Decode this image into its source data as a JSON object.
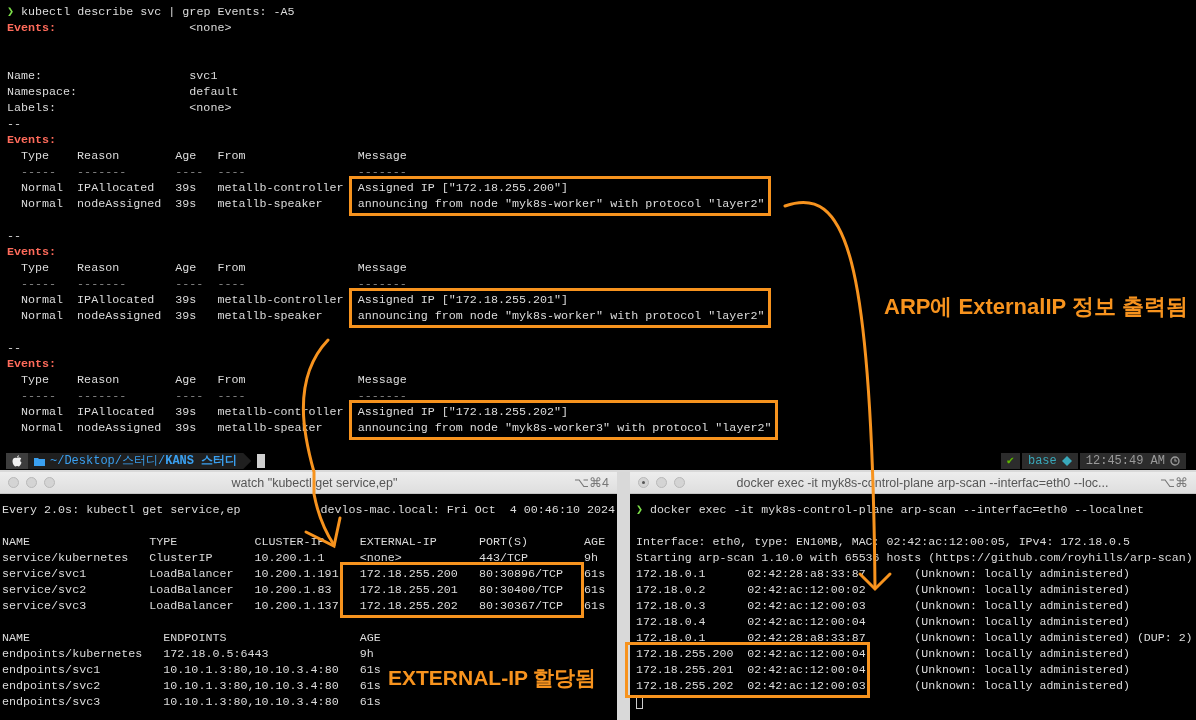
{
  "describe_terminal": {
    "lines": [
      {
        "kind": "command",
        "prompt": "❯",
        "text": "kubectl describe svc | grep Events: -A5"
      },
      {
        "kind": "events_field",
        "label": "Events:",
        "value": "<none>"
      },
      {
        "kind": "blank"
      },
      {
        "kind": "blank"
      },
      {
        "kind": "field",
        "label": "Name:",
        "value": "svc1"
      },
      {
        "kind": "field",
        "label": "Namespace:",
        "value": "default"
      },
      {
        "kind": "field",
        "label": "Labels:",
        "value": "<none>"
      },
      {
        "kind": "separator",
        "text": "--"
      },
      {
        "kind": "events_heading",
        "text": "Events:"
      },
      {
        "kind": "event_table",
        "columns": [
          "Type",
          "Reason",
          "Age",
          "From",
          "Message"
        ],
        "rules": [
          "-----",
          "-------",
          "----",
          "----",
          "-------"
        ],
        "events": [
          {
            "type": "Normal",
            "reason": "IPAllocated",
            "age": "39s",
            "from": "metallb-controller",
            "message": "Assigned IP [\"172.18.255.200\"]",
            "highlighted": true
          },
          {
            "type": "Normal",
            "reason": "nodeAssigned",
            "age": "39s",
            "from": "metallb-speaker",
            "message": "announcing from node \"myk8s-worker\" with protocol \"layer2\"",
            "highlighted": true
          }
        ]
      },
      {
        "kind": "blank"
      },
      {
        "kind": "separator",
        "text": "--"
      },
      {
        "kind": "events_heading",
        "text": "Events:"
      },
      {
        "kind": "event_table",
        "columns": [
          "Type",
          "Reason",
          "Age",
          "From",
          "Message"
        ],
        "rules": [
          "-----",
          "-------",
          "----",
          "----",
          "-------"
        ],
        "events": [
          {
            "type": "Normal",
            "reason": "IPAllocated",
            "age": "39s",
            "from": "metallb-controller",
            "message": "Assigned IP [\"172.18.255.201\"]",
            "highlighted": true
          },
          {
            "type": "Normal",
            "reason": "nodeAssigned",
            "age": "39s",
            "from": "metallb-speaker",
            "message": "announcing from node \"myk8s-worker\" with protocol \"layer2\"",
            "highlighted": true
          }
        ]
      },
      {
        "kind": "blank"
      },
      {
        "kind": "separator",
        "text": "--"
      },
      {
        "kind": "events_heading",
        "text": "Events:"
      },
      {
        "kind": "event_table",
        "columns": [
          "Type",
          "Reason",
          "Age",
          "From",
          "Message"
        ],
        "rules": [
          "-----",
          "-------",
          "----",
          "----",
          "-------"
        ],
        "events": [
          {
            "type": "Normal",
            "reason": "IPAllocated",
            "age": "39s",
            "from": "metallb-controller",
            "message": "Assigned IP [\"172.18.255.202\"]",
            "highlighted": true
          },
          {
            "type": "Normal",
            "reason": "nodeAssigned",
            "age": "39s",
            "from": "metallb-speaker",
            "message": "announcing from node \"myk8s-worker3\" with protocol \"layer2\"",
            "highlighted": true
          }
        ]
      }
    ]
  },
  "status_bar": {
    "path": "~/Desktop/스터디/**KANS 스터디**",
    "status": "✔",
    "environment": "base",
    "time": "12:45:49 AM"
  },
  "watch_window": {
    "title": "watch \"kubectl get service,ep\"",
    "shortcut": "⌥⌘4",
    "modified": false,
    "header": "Every 2.0s: kubectl get service,ep",
    "host_time": "devlos-mac.local: Fri Oct  4 00:46:10 2024",
    "services": {
      "columns": [
        "NAME",
        "TYPE",
        "CLUSTER-IP",
        "EXTERNAL-IP",
        "PORT(S)",
        "AGE"
      ],
      "rows": [
        {
          "cells": [
            "service/kubernetes",
            "ClusterIP",
            "10.200.1.1",
            "<none>",
            "443/TCP",
            "9h"
          ],
          "highlighted": false
        },
        {
          "cells": [
            "service/svc1",
            "LoadBalancer",
            "10.200.1.191",
            "172.18.255.200",
            "80:30896/TCP",
            "61s"
          ],
          "highlighted": true
        },
        {
          "cells": [
            "service/svc2",
            "LoadBalancer",
            "10.200.1.83",
            "172.18.255.201",
            "80:30400/TCP",
            "61s"
          ],
          "highlighted": true
        },
        {
          "cells": [
            "service/svc3",
            "LoadBalancer",
            "10.200.1.137",
            "172.18.255.202",
            "80:30367/TCP",
            "61s"
          ],
          "highlighted": true
        }
      ]
    },
    "endpoints": {
      "columns": [
        "NAME",
        "ENDPOINTS",
        "AGE"
      ],
      "rows": [
        {
          "cells": [
            "endpoints/kubernetes",
            "172.18.0.5:6443",
            "9h"
          ]
        },
        {
          "cells": [
            "endpoints/svc1",
            "10.10.1.3:80,10.10.3.4:80",
            "61s"
          ]
        },
        {
          "cells": [
            "endpoints/svc2",
            "10.10.1.3:80,10.10.3.4:80",
            "61s"
          ]
        },
        {
          "cells": [
            "endpoints/svc3",
            "10.10.1.3:80,10.10.3.4:80",
            "61s"
          ]
        }
      ]
    }
  },
  "arp_window": {
    "title": "docker exec -it myk8s-control-plane arp-scan --interfac=eth0 --loc...",
    "shortcut": "⌥⌘",
    "modified": true,
    "command": {
      "prompt": "❯",
      "text": "docker exec -it myk8s-control-plane arp-scan --interfac=eth0 --localnet"
    },
    "info_lines": [
      "Interface: eth0, type: EN10MB, MAC: 02:42:ac:12:00:05, IPv4: 172.18.0.5",
      "Starting arp-scan 1.10.0 with 65536 hosts (https://github.com/royhills/arp-scan)"
    ],
    "hosts": [
      {
        "ip": "172.18.0.1",
        "mac": "02:42:28:a8:33:87",
        "vendor": "(Unknown: locally administered)",
        "highlighted": false
      },
      {
        "ip": "172.18.0.2",
        "mac": "02:42:ac:12:00:02",
        "vendor": "(Unknown: locally administered)",
        "highlighted": false
      },
      {
        "ip": "172.18.0.3",
        "mac": "02:42:ac:12:00:03",
        "vendor": "(Unknown: locally administered)",
        "highlighted": false
      },
      {
        "ip": "172.18.0.4",
        "mac": "02:42:ac:12:00:04",
        "vendor": "(Unknown: locally administered)",
        "highlighted": false
      },
      {
        "ip": "172.18.0.1",
        "mac": "02:42:28:a8:33:87",
        "vendor": "(Unknown: locally administered) (DUP: 2)",
        "highlighted": false
      },
      {
        "ip": "172.18.255.200",
        "mac": "02:42:ac:12:00:04",
        "vendor": "(Unknown: locally administered)",
        "highlighted": true
      },
      {
        "ip": "172.18.255.201",
        "mac": "02:42:ac:12:00:04",
        "vendor": "(Unknown: locally administered)",
        "highlighted": true
      },
      {
        "ip": "172.18.255.202",
        "mac": "02:42:ac:12:00:03",
        "vendor": "(Unknown: locally administered)",
        "highlighted": true
      }
    ]
  },
  "annotations": [
    {
      "text": "EXTERNAL-IP 할당됨"
    },
    {
      "text": "ARP에 ExternalIP 정보 출력됨"
    }
  ]
}
